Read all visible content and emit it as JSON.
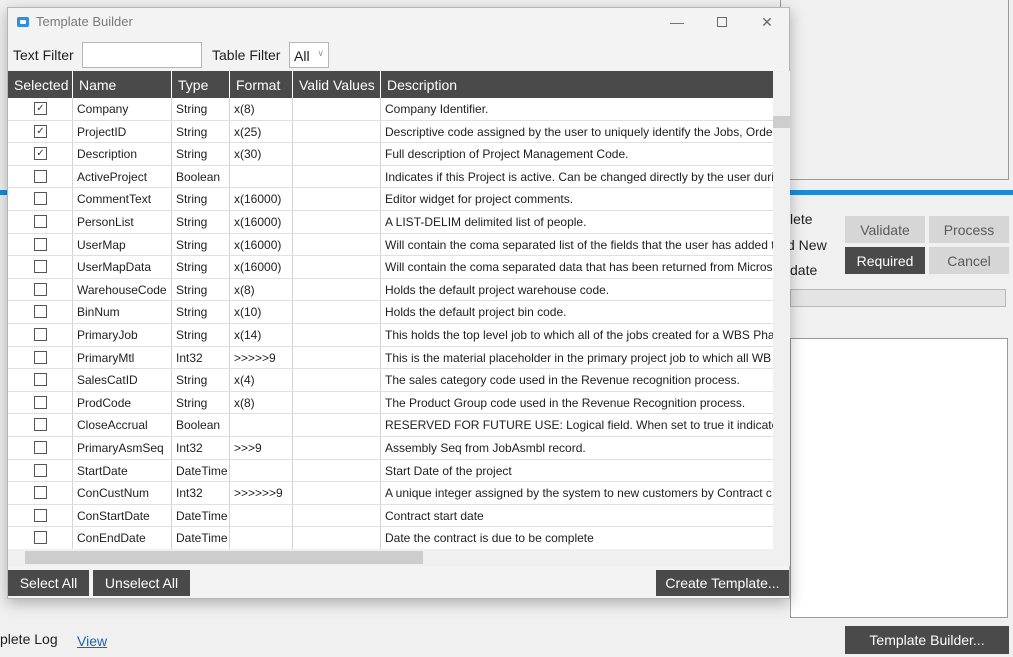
{
  "background": {
    "labels": [
      "lete",
      "d New",
      "date"
    ],
    "buttons": {
      "validate": "Validate",
      "process": "Process",
      "required": "Required",
      "cancel": "Cancel"
    },
    "bottom_label": "plete Log",
    "view_link": "View",
    "template_builder_button": "Template Builder..."
  },
  "dialog": {
    "title": "Template Builder",
    "window_controls": {
      "minimize": "—",
      "close": "✕"
    },
    "filters": {
      "text_filter_label": "Text Filter",
      "text_filter_value": "",
      "table_filter_label": "Table Filter",
      "table_filter_value": "All"
    },
    "columns": [
      "Selected",
      "Name",
      "Type",
      "Format",
      "Valid Values",
      "Description"
    ],
    "rows": [
      {
        "selected": true,
        "name": "Company",
        "type": "String",
        "format": "x(8)",
        "valid_values": "",
        "description": "Company Identifier."
      },
      {
        "selected": true,
        "name": "ProjectID",
        "type": "String",
        "format": "x(25)",
        "valid_values": "",
        "description": "Descriptive code assigned by the user to uniquely identify the Jobs, Order"
      },
      {
        "selected": true,
        "name": "Description",
        "type": "String",
        "format": "x(30)",
        "valid_values": "",
        "description": "Full description of Project Management Code."
      },
      {
        "selected": false,
        "name": "ActiveProject",
        "type": "Boolean",
        "format": "",
        "valid_values": "",
        "description": "Indicates if this Project is active.  Can be changed directly by the user duri"
      },
      {
        "selected": false,
        "name": "CommentText",
        "type": "String",
        "format": "x(16000)",
        "valid_values": "",
        "description": "Editor widget for project comments."
      },
      {
        "selected": false,
        "name": "PersonList",
        "type": "String",
        "format": "x(16000)",
        "valid_values": "",
        "description": "A LIST-DELIM delimited list of people."
      },
      {
        "selected": false,
        "name": "UserMap",
        "type": "String",
        "format": "x(16000)",
        "valid_values": "",
        "description": "Will contain the coma separated list of the fields that the user has added t"
      },
      {
        "selected": false,
        "name": "UserMapData",
        "type": "String",
        "format": "x(16000)",
        "valid_values": "",
        "description": "Will contain the coma separated data that has been returned from Micros"
      },
      {
        "selected": false,
        "name": "WarehouseCode",
        "type": "String",
        "format": "x(8)",
        "valid_values": "",
        "description": "Holds the default project warehouse code."
      },
      {
        "selected": false,
        "name": "BinNum",
        "type": "String",
        "format": "x(10)",
        "valid_values": "",
        "description": "Holds the default project bin code."
      },
      {
        "selected": false,
        "name": "PrimaryJob",
        "type": "String",
        "format": "x(14)",
        "valid_values": "",
        "description": "This holds the top level job to which all of the jobs created for a WBS Pha"
      },
      {
        "selected": false,
        "name": "PrimaryMtl",
        "type": "Int32",
        "format": ">>>>>9",
        "valid_values": "",
        "description": "This is the material placeholder in the primary project job to which all WB"
      },
      {
        "selected": false,
        "name": "SalesCatID",
        "type": "String",
        "format": "x(4)",
        "valid_values": "",
        "description": "The sales category code used in the Revenue recognition process."
      },
      {
        "selected": false,
        "name": "ProdCode",
        "type": "String",
        "format": "x(8)",
        "valid_values": "",
        "description": "The Product Group code used in the Revenue Recognition process."
      },
      {
        "selected": false,
        "name": "CloseAccrual",
        "type": "Boolean",
        "format": "",
        "valid_values": "",
        "description": "RESERVED FOR FUTURE USE: Logical field. When set to true it indicates th"
      },
      {
        "selected": false,
        "name": "PrimaryAsmSeq",
        "type": "Int32",
        "format": ">>>9",
        "valid_values": "",
        "description": "Assembly Seq from JobAsmbl record."
      },
      {
        "selected": false,
        "name": "StartDate",
        "type": "DateTime",
        "format": "",
        "valid_values": "",
        "description": "Start Date of the project"
      },
      {
        "selected": false,
        "name": "ConCustNum",
        "type": "Int32",
        "format": ">>>>>>9",
        "valid_values": "",
        "description": "A  unique integer assigned by the system to new customers by Contract c"
      },
      {
        "selected": false,
        "name": "ConStartDate",
        "type": "DateTime",
        "format": "",
        "valid_values": "",
        "description": "Contract start date"
      },
      {
        "selected": false,
        "name": "ConEndDate",
        "type": "DateTime",
        "format": "",
        "valid_values": "",
        "description": "Date the contract is due to be complete"
      }
    ],
    "buttons": {
      "select_all": "Select All",
      "unselect_all": "Unselect All",
      "create_template": "Create Template..."
    }
  }
}
